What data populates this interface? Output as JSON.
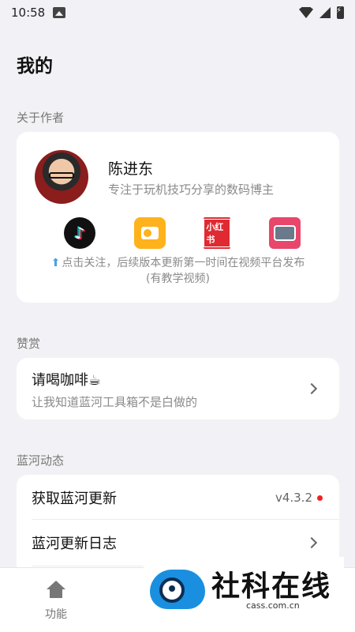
{
  "status_bar": {
    "time": "10:58"
  },
  "page_title": "我的",
  "sections": {
    "about_author": "关于作者",
    "reward": "赞赏",
    "updates": "蓝河动态"
  },
  "author": {
    "name": "陈进东",
    "bio": "专注于玩机技巧分享的数码博主",
    "platforms": [
      "douyin-icon",
      "kuaishou-icon",
      "xiaohongshu-icon",
      "bilibili-tv-icon"
    ],
    "xhs_text": "小红书",
    "note_line1": "点击关注，后续版本更新第一时间在视频平台发布",
    "note_line2": "(有教学视频)"
  },
  "reward": {
    "title": "请喝咖啡☕",
    "subtitle": "让我知道蓝河工具箱不是白做的"
  },
  "updates": {
    "get_update": "获取蓝河更新",
    "version": "v4.3.2",
    "changelog": "蓝河更新日志"
  },
  "bottom_nav": {
    "features": "功能"
  },
  "watermark": {
    "title": "社科在线",
    "sub": "cass.com.cn"
  },
  "colors": {
    "background": "#f2f2f6",
    "card": "#ffffff",
    "update_dot": "#ee2222",
    "accent_blue": "#1a8fe0"
  }
}
